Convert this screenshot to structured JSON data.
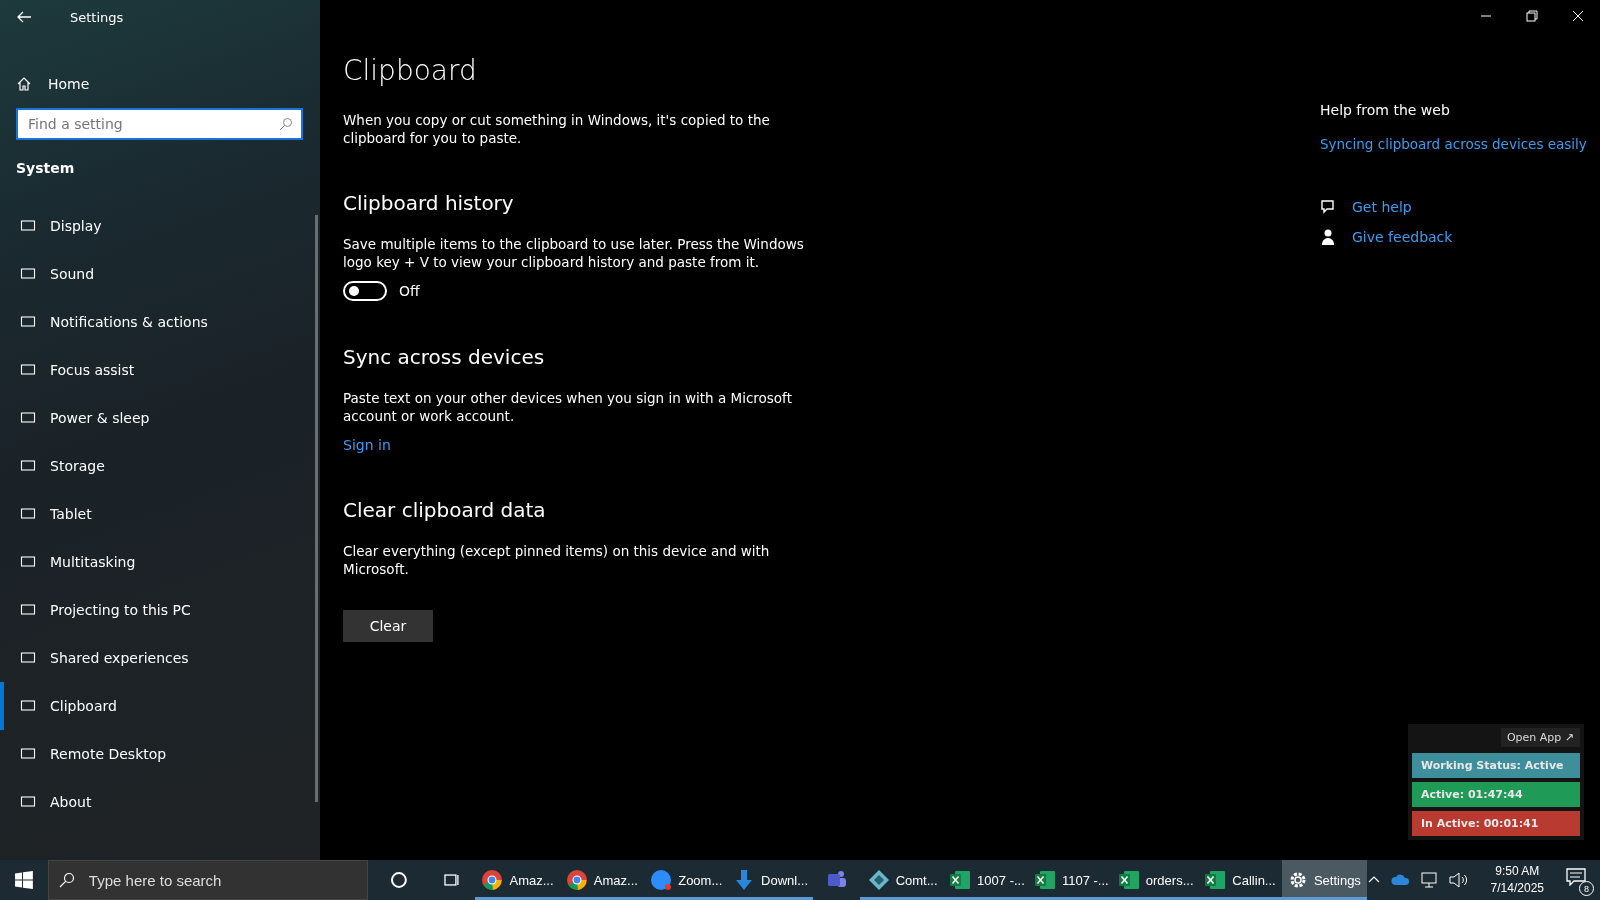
{
  "window": {
    "title": "Settings"
  },
  "sidebar": {
    "home": "Home",
    "search": {
      "placeholder": "Find a setting"
    },
    "section": "System",
    "items": [
      {
        "label": "Display",
        "selected": false
      },
      {
        "label": "Sound",
        "selected": false
      },
      {
        "label": "Notifications & actions",
        "selected": false
      },
      {
        "label": "Focus assist",
        "selected": false
      },
      {
        "label": "Power & sleep",
        "selected": false
      },
      {
        "label": "Storage",
        "selected": false
      },
      {
        "label": "Tablet",
        "selected": false
      },
      {
        "label": "Multitasking",
        "selected": false
      },
      {
        "label": "Projecting to this PC",
        "selected": false
      },
      {
        "label": "Shared experiences",
        "selected": false
      },
      {
        "label": "Clipboard",
        "selected": true
      },
      {
        "label": "Remote Desktop",
        "selected": false
      },
      {
        "label": "About",
        "selected": false
      }
    ]
  },
  "page": {
    "title": "Clipboard",
    "intro": "When you copy or cut something in Windows, it's copied to the clipboard for you to paste.",
    "history": {
      "heading": "Clipboard history",
      "text": "Save multiple items to the clipboard to use later. Press the Windows logo key + V to view your clipboard history and paste from it.",
      "toggle": {
        "on": false,
        "label": "Off"
      }
    },
    "sync": {
      "heading": "Sync across devices",
      "text": "Paste text on your other devices when you sign in with a Microsoft account or work account.",
      "link": "Sign in"
    },
    "clear": {
      "heading": "Clear clipboard data",
      "text": "Clear everything (except pinned items) on this device and with Microsoft.",
      "button": "Clear"
    }
  },
  "help": {
    "heading": "Help from the web",
    "link": "Syncing clipboard across devices easily",
    "get_help": "Get help",
    "feedback": "Give feedback"
  },
  "widget": {
    "open_app": "Open App ↗",
    "status": "Working Status: Active",
    "active": "Active: 01:47:44",
    "inactive": "In Active: 00:01:41"
  },
  "taskbar": {
    "search": "Type here to search",
    "apps": [
      {
        "kind": "chrome",
        "label": "Amaz...",
        "selected": false
      },
      {
        "kind": "chrome",
        "label": "Amaz...",
        "selected": false
      },
      {
        "kind": "zoom",
        "label": "Zoom...",
        "selected": false
      },
      {
        "kind": "download",
        "label": "Downl...",
        "selected": false
      },
      {
        "kind": "teams",
        "selected": false
      },
      {
        "kind": "diamond",
        "label": "Comt...",
        "selected": false
      },
      {
        "kind": "excel",
        "label": "1007 -...",
        "selected": false
      },
      {
        "kind": "excel",
        "label": "1107 -...",
        "selected": false
      },
      {
        "kind": "excel",
        "label": "orders...",
        "selected": false
      },
      {
        "kind": "excel",
        "label": "Callin...",
        "selected": false
      },
      {
        "kind": "settings",
        "label": "Settings",
        "selected": true
      }
    ],
    "time": "9:50 AM",
    "date": "7/14/2025",
    "notifications": "8"
  }
}
